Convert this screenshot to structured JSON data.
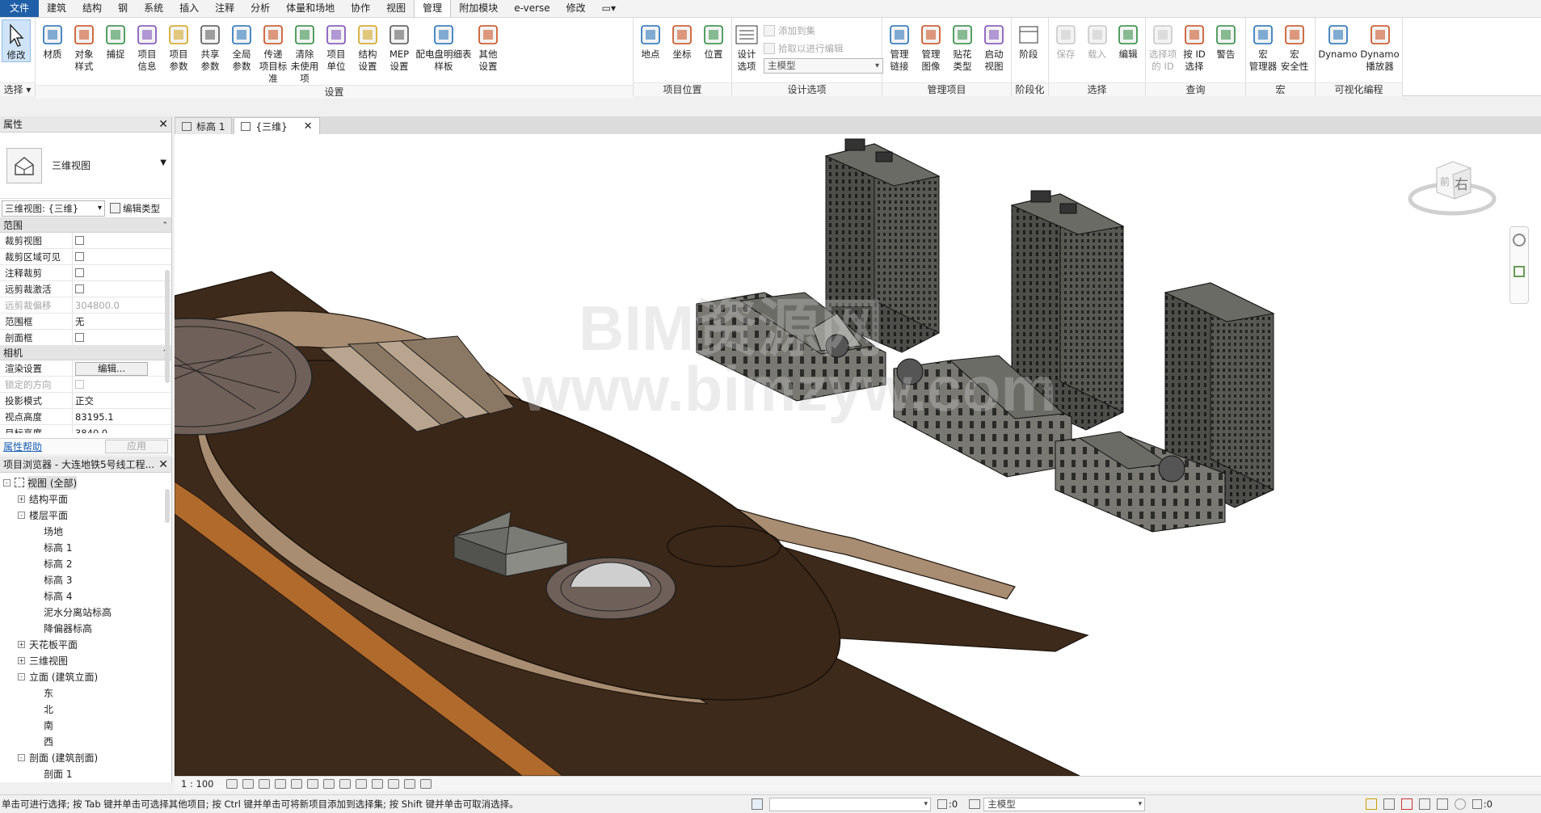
{
  "tabs": [
    "文件",
    "建筑",
    "结构",
    "钢",
    "系统",
    "插入",
    "注释",
    "分析",
    "体量和场地",
    "协作",
    "视图",
    "管理",
    "附加模块",
    "e-verse",
    "修改"
  ],
  "tabs_active_index": 11,
  "ribbon": {
    "select": {
      "tool": "修改",
      "title": "选择 ▾"
    },
    "settings": {
      "title": "设置",
      "tools": [
        "材质",
        "对象\n样式",
        "捕捉",
        "项目\n信息",
        "项目\n参数",
        "共享\n参数",
        "全局\n参数",
        "传递\n项目标准",
        "清除\n未使用项",
        "项目\n单位",
        "结构\n设置",
        "MEP\n设置",
        "配电盘明细表\n样板",
        "其他\n设置"
      ]
    },
    "location": {
      "title": "项目位置",
      "tools": [
        "地点",
        "坐标",
        "位置"
      ]
    },
    "design_options": {
      "title": "设计选项",
      "tool": "设计\n选项",
      "add_to_set": "添加到集",
      "pick_to_edit": "拾取以进行编辑",
      "combo": "主模型"
    },
    "manage_project": {
      "title": "管理项目",
      "tools": [
        "管理\n链接",
        "管理\n图像",
        "贴花\n类型",
        "启动\n视图"
      ]
    },
    "phasing": {
      "title": "阶段化",
      "tool": "阶段"
    },
    "selection": {
      "title": "选择",
      "tools": [
        "保存",
        "载入",
        "编辑"
      ]
    },
    "inquiry": {
      "title": "查询",
      "tools": [
        "选择项\n的 ID",
        "按 ID\n选择",
        "警告"
      ]
    },
    "macros": {
      "title": "宏",
      "tools": [
        "宏\n管理器",
        "宏\n安全性"
      ]
    },
    "visual_programming": {
      "title": "可视化编程",
      "tools": [
        "Dynamo",
        "Dynamo\n播放器"
      ]
    }
  },
  "properties": {
    "title": "属性",
    "type_name": "三维视图",
    "instance_selector": "三维视图: {三维}",
    "edit_type": "编辑类型",
    "groups": [
      {
        "name": "范围",
        "rows": [
          {
            "key": "裁剪视图",
            "type": "checkbox",
            "disabled": false
          },
          {
            "key": "裁剪区域可见",
            "type": "checkbox",
            "disabled": false
          },
          {
            "key": "注释裁剪",
            "type": "checkbox",
            "disabled": false
          },
          {
            "key": "远剪裁激活",
            "type": "checkbox",
            "disabled": false
          },
          {
            "key": "远剪裁偏移",
            "value": "304800.0",
            "disabled": true
          },
          {
            "key": "范围框",
            "value": "无",
            "disabled": false
          },
          {
            "key": "剖面框",
            "type": "checkbox",
            "disabled": false
          }
        ]
      },
      {
        "name": "相机",
        "rows": [
          {
            "key": "渲染设置",
            "type": "button",
            "value": "编辑...",
            "disabled": false
          },
          {
            "key": "锁定的方向",
            "type": "checkbox",
            "disabled": true
          },
          {
            "key": "投影模式",
            "value": "正交",
            "disabled": false
          },
          {
            "key": "视点高度",
            "value": "83195.1",
            "disabled": false
          },
          {
            "key": "目标高度",
            "value": "3840.0",
            "disabled": false
          }
        ]
      }
    ],
    "help": "属性帮助",
    "apply": "应用"
  },
  "browser": {
    "title": "项目浏览器 - 大连地铁5号线工程...",
    "items": [
      {
        "label": "视图 (全部)",
        "level": 0,
        "toggle": "-",
        "root": true
      },
      {
        "label": "结构平面",
        "level": 1,
        "toggle": "+"
      },
      {
        "label": "楼层平面",
        "level": 1,
        "toggle": "-"
      },
      {
        "label": "场地",
        "level": 2
      },
      {
        "label": "标高 1",
        "level": 2
      },
      {
        "label": "标高 2",
        "level": 2
      },
      {
        "label": "标高 3",
        "level": 2
      },
      {
        "label": "标高 4",
        "level": 2
      },
      {
        "label": "泥水分离站标高",
        "level": 2
      },
      {
        "label": "降偏器标高",
        "level": 2
      },
      {
        "label": "天花板平面",
        "level": 1,
        "toggle": "+"
      },
      {
        "label": "三维视图",
        "level": 1,
        "toggle": "+"
      },
      {
        "label": "立面 (建筑立面)",
        "level": 1,
        "toggle": "-"
      },
      {
        "label": "东",
        "level": 2
      },
      {
        "label": "北",
        "level": 2
      },
      {
        "label": "南",
        "level": 2
      },
      {
        "label": "西",
        "level": 2
      },
      {
        "label": "剖面 (建筑剖面)",
        "level": 1,
        "toggle": "-"
      },
      {
        "label": "剖面 1",
        "level": 2
      }
    ]
  },
  "view_tabs": [
    {
      "label": "标高 1",
      "active": false
    },
    {
      "label": "{三维}",
      "active": true
    }
  ],
  "viewcube": {
    "face_label": "右",
    "side_label": "前"
  },
  "watermark": {
    "line1": "BIM资源网",
    "line2": "www.bimzyw.com"
  },
  "view_control": {
    "scale": "1 : 100"
  },
  "status": {
    "message": "单击可进行选择; 按 Tab 键并单击可选择其他项目; 按 Ctrl 键并单击可将新项目添加到选择集; 按 Shift 键并单击可取消选择。",
    "workset_count": ":0",
    "model_combo": "主模型",
    "filter_count": ":0"
  },
  "colors": {
    "file_tab": "#1f5fa8",
    "ground_dark": "#3e2a1a",
    "ground_path": "#a88d72",
    "building": "#4a4a46"
  }
}
